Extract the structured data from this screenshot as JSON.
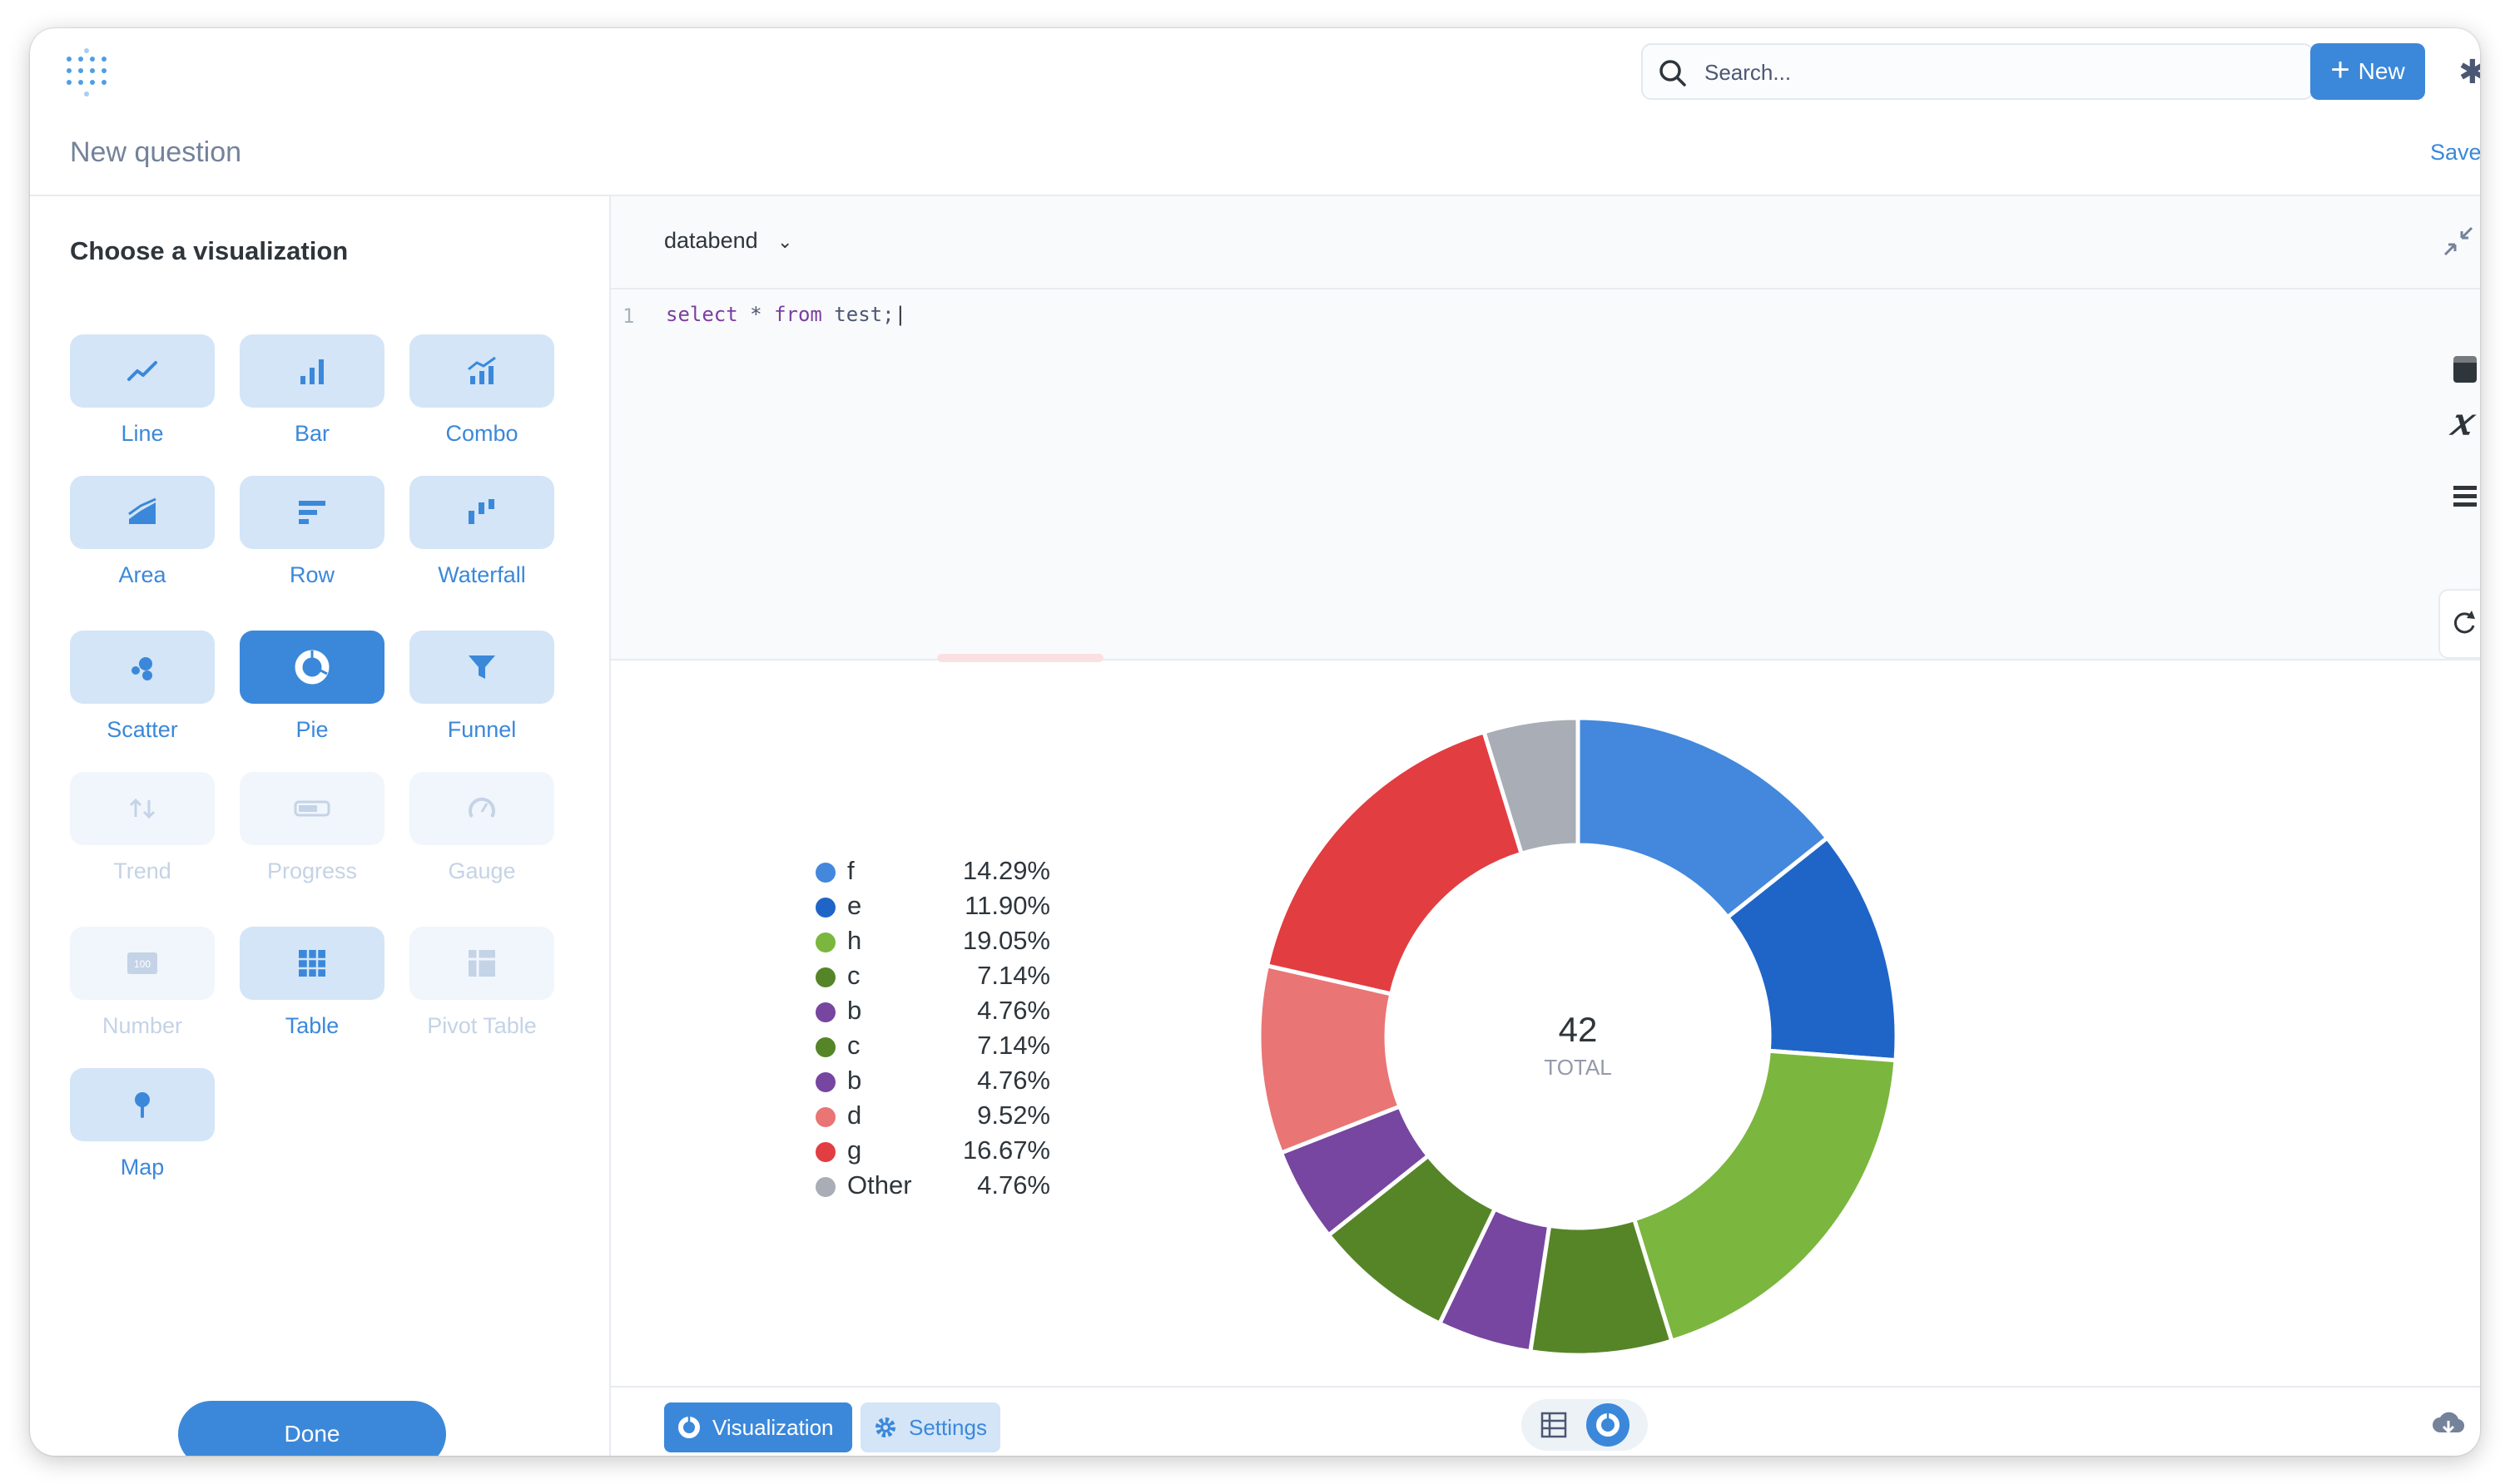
{
  "header": {
    "search_placeholder": "Search...",
    "new_label": "New",
    "page_title": "New question",
    "save_label": "Save"
  },
  "sidebar": {
    "heading": "Choose a visualization",
    "items": [
      {
        "label": "Line",
        "icon": "line-chart-icon",
        "state": "enabled"
      },
      {
        "label": "Bar",
        "icon": "bar-chart-icon",
        "state": "enabled"
      },
      {
        "label": "Combo",
        "icon": "combo-chart-icon",
        "state": "enabled"
      },
      {
        "label": "Area",
        "icon": "area-chart-icon",
        "state": "enabled"
      },
      {
        "label": "Row",
        "icon": "row-chart-icon",
        "state": "enabled"
      },
      {
        "label": "Waterfall",
        "icon": "waterfall-chart-icon",
        "state": "enabled"
      },
      {
        "label": "Scatter",
        "icon": "scatter-chart-icon",
        "state": "enabled"
      },
      {
        "label": "Pie",
        "icon": "pie-chart-icon",
        "state": "selected"
      },
      {
        "label": "Funnel",
        "icon": "funnel-icon",
        "state": "enabled"
      },
      {
        "label": "Trend",
        "icon": "trend-icon",
        "state": "disabled"
      },
      {
        "label": "Progress",
        "icon": "progress-icon",
        "state": "disabled"
      },
      {
        "label": "Gauge",
        "icon": "gauge-icon",
        "state": "disabled"
      },
      {
        "label": "Number",
        "icon": "number-icon",
        "state": "disabled"
      },
      {
        "label": "Table",
        "icon": "table-icon",
        "state": "enabled"
      },
      {
        "label": "Pivot Table",
        "icon": "pivot-table-icon",
        "state": "disabled"
      },
      {
        "label": "Map",
        "icon": "map-pin-icon",
        "state": "enabled"
      }
    ],
    "done_label": "Done"
  },
  "editor": {
    "database": "databend",
    "line_number": "1",
    "query": {
      "kw1": "select",
      "mid": " * ",
      "kw2": "from",
      "rest": " test;"
    }
  },
  "footer": {
    "visualization_label": "Visualization",
    "settings_label": "Settings"
  },
  "chart_data": {
    "type": "pie",
    "donut": true,
    "total_value": "42",
    "total_label": "TOTAL",
    "legend_position": "left",
    "slices": [
      {
        "name": "f",
        "value": 14.29,
        "label": "14.29%",
        "color": "#4388dc"
      },
      {
        "name": "e",
        "value": 11.9,
        "label": "11.90%",
        "color": "#1f65c8"
      },
      {
        "name": "h",
        "value": 19.05,
        "label": "19.05%",
        "color": "#7bb63e"
      },
      {
        "name": "c",
        "value": 7.14,
        "label": "7.14%",
        "color": "#568528"
      },
      {
        "name": "b",
        "value": 4.76,
        "label": "4.76%",
        "color": "#7646a0"
      },
      {
        "name": "c",
        "value": 7.14,
        "label": "7.14%",
        "color": "#568528"
      },
      {
        "name": "b",
        "value": 4.76,
        "label": "4.76%",
        "color": "#7646a0"
      },
      {
        "name": "d",
        "value": 9.52,
        "label": "9.52%",
        "color": "#e97575"
      },
      {
        "name": "g",
        "value": 16.67,
        "label": "16.67%",
        "color": "#e23d41"
      },
      {
        "name": "Other",
        "value": 4.76,
        "label": "4.76%",
        "color": "#a9adb5"
      }
    ]
  }
}
